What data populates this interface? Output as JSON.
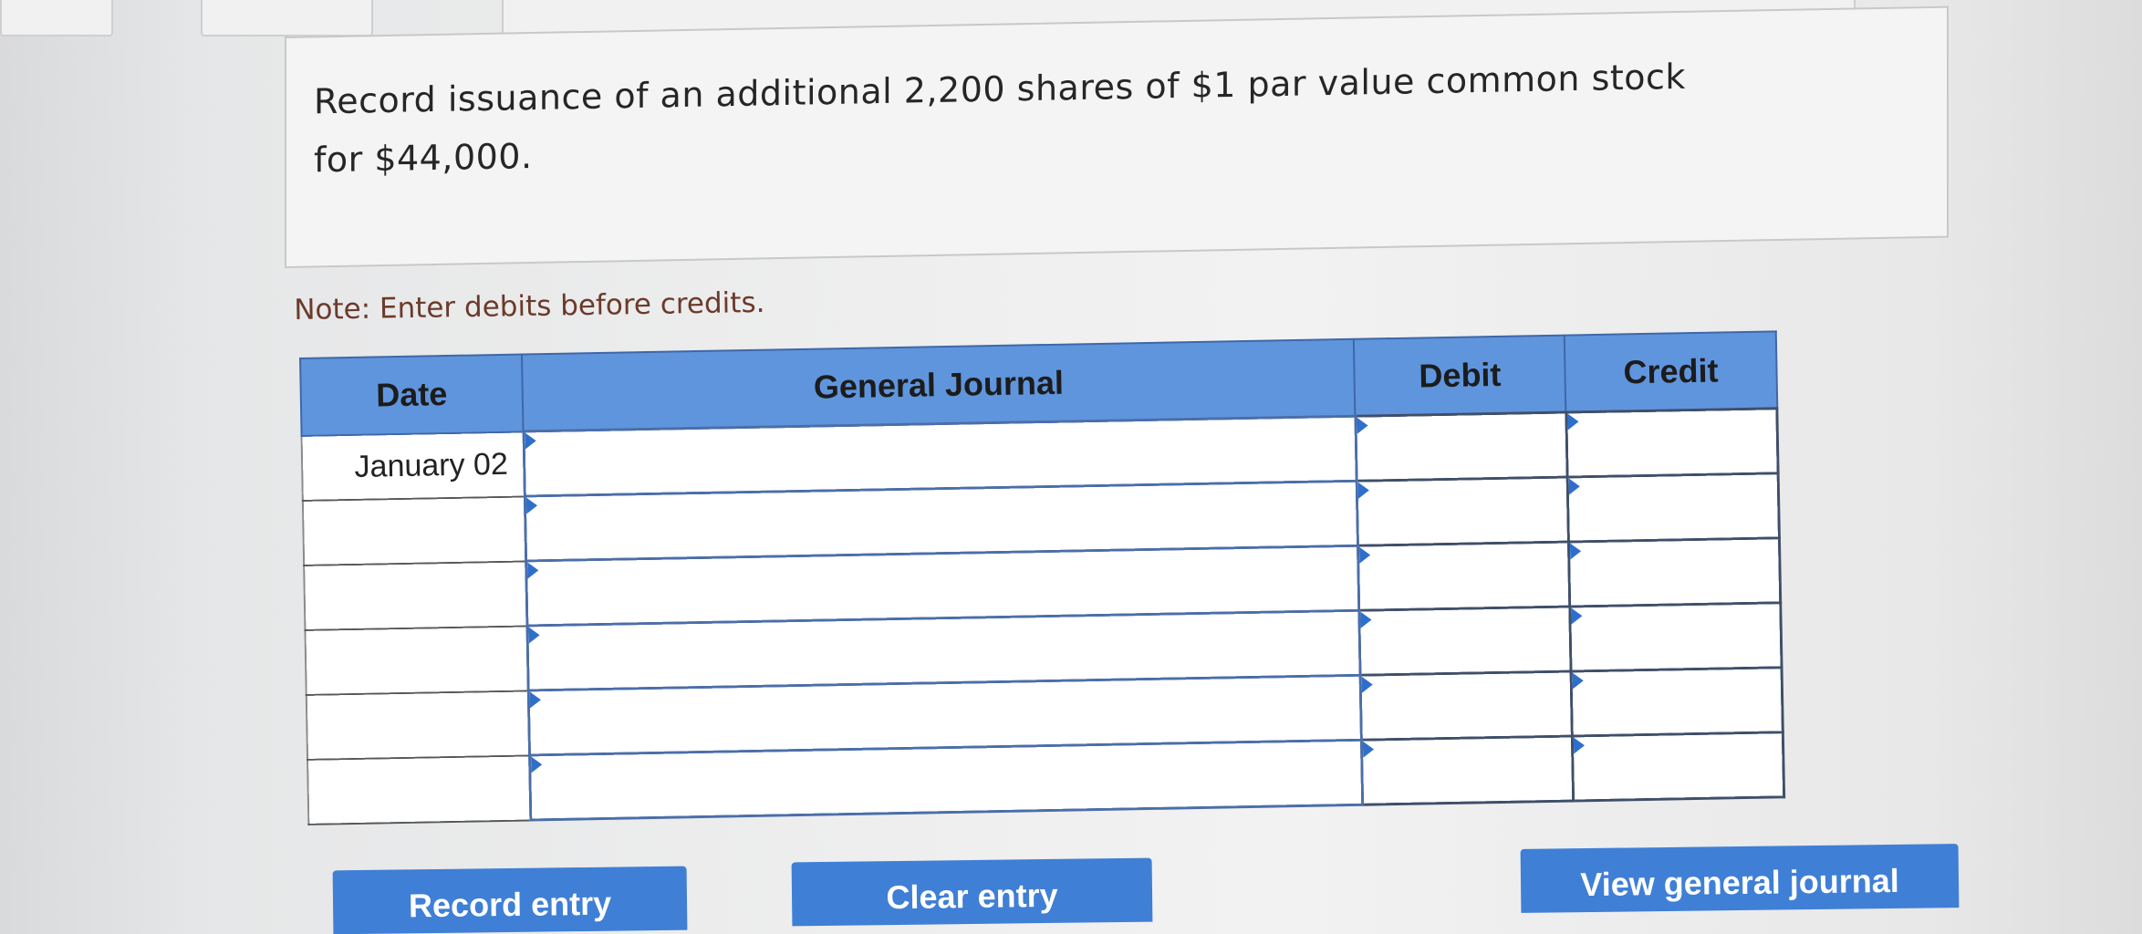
{
  "prompt": {
    "text": "Record issuance of an additional 2,200 shares of $1 par value common stock for $44,000."
  },
  "note": "Note: Enter debits before credits.",
  "journal": {
    "headers": {
      "date": "Date",
      "account": "General Journal",
      "debit": "Debit",
      "credit": "Credit"
    },
    "rows": [
      {
        "date": "January 02",
        "account": "",
        "debit": "",
        "credit": ""
      },
      {
        "date": "",
        "account": "",
        "debit": "",
        "credit": ""
      },
      {
        "date": "",
        "account": "",
        "debit": "",
        "credit": ""
      },
      {
        "date": "",
        "account": "",
        "debit": "",
        "credit": ""
      },
      {
        "date": "",
        "account": "",
        "debit": "",
        "credit": ""
      },
      {
        "date": "",
        "account": "",
        "debit": "",
        "credit": ""
      }
    ]
  },
  "buttons": {
    "record": "Record entry",
    "clear": "Clear entry",
    "view": "View general journal"
  },
  "colors": {
    "header_blue": "#5f95dd",
    "button_blue": "#3f7fd6",
    "note_brown": "#6b3a2a"
  }
}
